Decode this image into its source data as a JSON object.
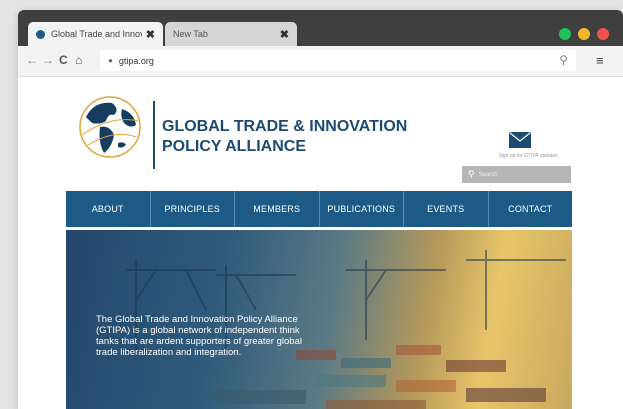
{
  "browser": {
    "tabs": [
      {
        "label": "Global Trade and Innov..."
      },
      {
        "label": "New Tab"
      }
    ],
    "tab_close_glyph": "✖",
    "url": "gtipa.org",
    "controls": {
      "dot_colors": [
        "#1fc35a",
        "#f5b629",
        "#f0544c"
      ]
    }
  },
  "site": {
    "logo": {
      "line1": "GLOBAL TRADE & INNOVATION",
      "line2": "POLICY ALLIANCE"
    },
    "signup_text": "Sign up for GTIPA updates",
    "search_placeholder": "Search",
    "nav": [
      {
        "label": "ABOUT"
      },
      {
        "label": "PRINCIPLES"
      },
      {
        "label": "MEMBERS"
      },
      {
        "label": "PUBLICATIONS"
      },
      {
        "label": "EVENTS"
      },
      {
        "label": "CONTACT"
      }
    ],
    "hero_text": "The Global Trade and Innovation Policy Alliance (GTIPA) is a global network of independent think tanks that are ardent supporters of greater global trade liberalization and integration.",
    "colors": {
      "brand": "#1b4b73",
      "nav_bg": "#1d5b86"
    }
  }
}
